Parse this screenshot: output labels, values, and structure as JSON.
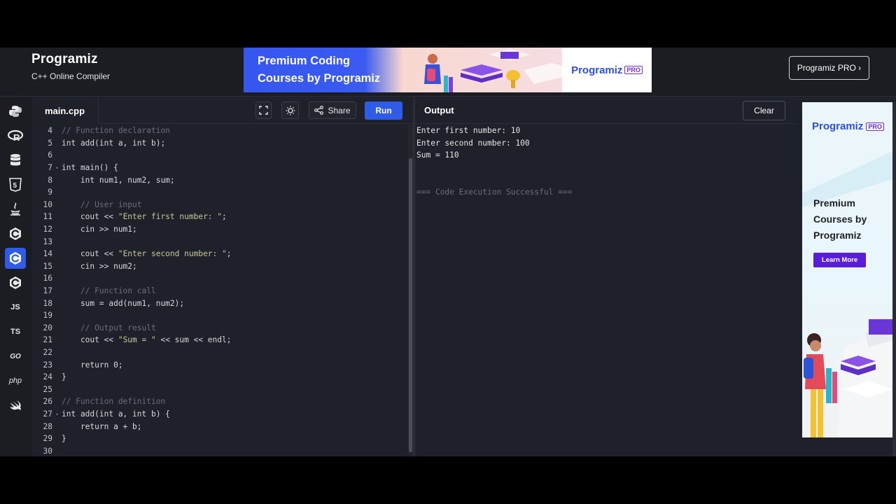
{
  "header": {
    "logo": "Programiz",
    "subtitle": "C++ Online Compiler",
    "banner_line1": "Premium Coding",
    "banner_line2": "Courses by Programiz",
    "banner_brand": "Programiz",
    "banner_pro": "PRO",
    "pro_button": "Programiz PRO ›"
  },
  "sidebar": {
    "items": [
      {
        "icon": "python-icon",
        "label": ""
      },
      {
        "icon": "r-icon",
        "label": ""
      },
      {
        "icon": "sql-icon",
        "label": ""
      },
      {
        "icon": "html-icon",
        "label": ""
      },
      {
        "icon": "java-icon",
        "label": ""
      },
      {
        "icon": "c-icon",
        "label": ""
      },
      {
        "icon": "cpp-icon",
        "label": ""
      },
      {
        "icon": "csharp-icon",
        "label": ""
      },
      {
        "icon": "js-icon",
        "label": "JS"
      },
      {
        "icon": "ts-icon",
        "label": "TS"
      },
      {
        "icon": "go-icon",
        "label": "GO"
      },
      {
        "icon": "php-icon",
        "label": "php"
      },
      {
        "icon": "swift-icon",
        "label": ""
      }
    ],
    "active_index": 6
  },
  "editor": {
    "file_tab": "main.cpp",
    "share_label": "Share",
    "run_label": "Run",
    "lines": [
      {
        "n": "4",
        "text": "// Function declaration",
        "kind": "comment"
      },
      {
        "n": "5",
        "text": "int add(int a, int b);",
        "kind": "code"
      },
      {
        "n": "6",
        "text": "",
        "kind": "code"
      },
      {
        "n": "7",
        "text": "int main() {",
        "kind": "code",
        "fold": true
      },
      {
        "n": "8",
        "text": "    int num1, num2, sum;",
        "kind": "code"
      },
      {
        "n": "9",
        "text": "",
        "kind": "code"
      },
      {
        "n": "10",
        "text": "    // User input",
        "kind": "comment"
      },
      {
        "n": "11",
        "text": "    cout << \"Enter first number: \";",
        "kind": "code"
      },
      {
        "n": "12",
        "text": "    cin >> num1;",
        "kind": "code"
      },
      {
        "n": "13",
        "text": "",
        "kind": "code"
      },
      {
        "n": "14",
        "text": "    cout << \"Enter second number: \";",
        "kind": "code"
      },
      {
        "n": "15",
        "text": "    cin >> num2;",
        "kind": "code"
      },
      {
        "n": "16",
        "text": "",
        "kind": "code"
      },
      {
        "n": "17",
        "text": "    // Function call",
        "kind": "comment"
      },
      {
        "n": "18",
        "text": "    sum = add(num1, num2);",
        "kind": "code"
      },
      {
        "n": "19",
        "text": "",
        "kind": "code"
      },
      {
        "n": "20",
        "text": "    // Output result",
        "kind": "comment"
      },
      {
        "n": "21",
        "text": "    cout << \"Sum = \" << sum << endl;",
        "kind": "code"
      },
      {
        "n": "22",
        "text": "",
        "kind": "code"
      },
      {
        "n": "23",
        "text": "    return 0;",
        "kind": "code"
      },
      {
        "n": "24",
        "text": "}",
        "kind": "code"
      },
      {
        "n": "25",
        "text": "",
        "kind": "code"
      },
      {
        "n": "26",
        "text": "// Function definition",
        "kind": "comment"
      },
      {
        "n": "27",
        "text": "int add(int a, int b) {",
        "kind": "code",
        "fold": true
      },
      {
        "n": "28",
        "text": "    return a + b;",
        "kind": "code"
      },
      {
        "n": "29",
        "text": "}",
        "kind": "code"
      },
      {
        "n": "30",
        "text": "",
        "kind": "code"
      }
    ]
  },
  "output": {
    "title": "Output",
    "clear_label": "Clear",
    "lines": [
      "Enter first number: 10",
      "Enter second number: 100",
      "Sum = 110",
      "",
      "",
      "=== Code Execution Successful ==="
    ]
  },
  "side_ad": {
    "brand": "Programiz",
    "pro": "PRO",
    "line1": "Premium",
    "line2": "Courses by",
    "line3": "Programiz",
    "button": "Learn More"
  },
  "colors": {
    "accent": "#2f5bea",
    "comment": "#6b6e76",
    "string": "#c8c89a",
    "keyword": "#e8e8e8",
    "pro_purple": "#5b1ed8"
  }
}
